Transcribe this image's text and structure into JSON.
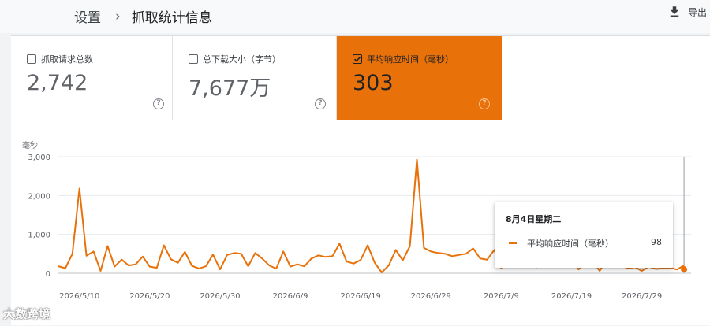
{
  "header": {
    "breadcrumb": [
      "设置",
      "抓取统计信息"
    ],
    "separator": "›",
    "export_label": "导出"
  },
  "metrics": [
    {
      "label": "抓取请求总数",
      "value": "2,742",
      "checked": false
    },
    {
      "label": "总下载大小（字节）",
      "value": "7,677万",
      "checked": false
    },
    {
      "label": "平均响应时间（毫秒）",
      "value": "303",
      "checked": true
    }
  ],
  "help_glyph": "?",
  "accent_color": "#e8710a",
  "tooltip": {
    "date": "8月4日星期二",
    "series": "平均响应时间（毫秒）",
    "value": "98"
  },
  "watermark": "大数跨境",
  "chart_data": {
    "type": "line",
    "ylabel": "毫秒",
    "ylim": [
      0,
      3000
    ],
    "yticks": [
      "0",
      "1,000",
      "2,000",
      "3,000"
    ],
    "yticks_values": [
      0,
      1000,
      2000,
      3000
    ],
    "xticks": [
      "2026/5/10",
      "2026/5/20",
      "2026/5/30",
      "2026/6/9",
      "2026/6/19",
      "2026/6/29",
      "2026/7/9",
      "2026/7/19",
      "2026/7/29"
    ],
    "x_start": "2026/5/7",
    "x_end": "2026/8/5",
    "grid": true,
    "series": [
      {
        "name": "平均响应时间（毫秒）",
        "color": "#e8710a",
        "values": [
          180,
          130,
          500,
          2180,
          450,
          560,
          60,
          700,
          170,
          350,
          200,
          230,
          430,
          170,
          140,
          720,
          360,
          270,
          550,
          190,
          120,
          180,
          480,
          100,
          470,
          520,
          500,
          180,
          520,
          380,
          200,
          120,
          560,
          170,
          230,
          180,
          380,
          460,
          420,
          440,
          760,
          300,
          250,
          340,
          720,
          270,
          20,
          200,
          600,
          330,
          700,
          2930,
          650,
          560,
          520,
          500,
          440,
          470,
          500,
          640,
          380,
          350,
          600,
          130,
          600,
          350,
          260,
          210,
          150,
          520,
          300,
          380,
          320,
          340,
          100,
          250,
          320,
          60,
          350,
          200,
          220,
          120,
          160,
          60,
          170,
          110,
          130,
          140,
          98,
          200
        ]
      }
    ],
    "highlight_date": "2026/8/4",
    "highlight_value": 98
  }
}
